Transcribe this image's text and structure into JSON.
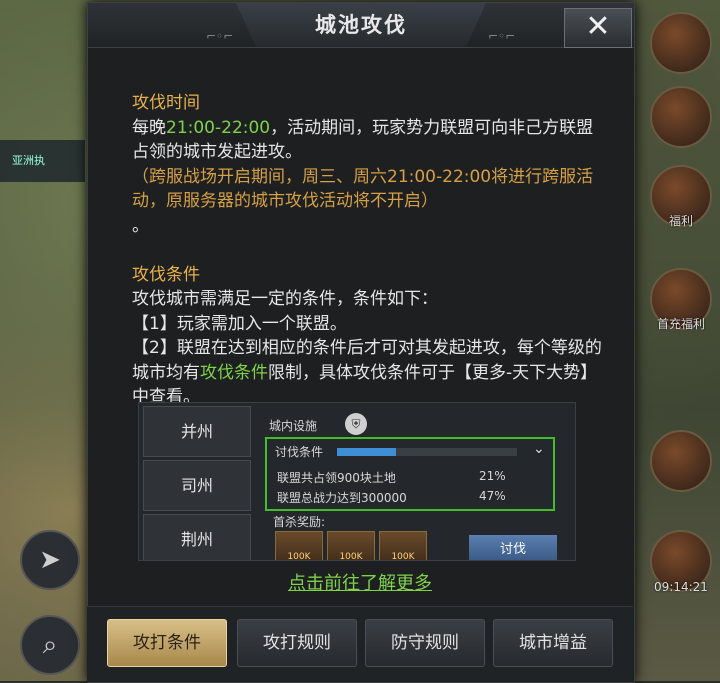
{
  "background": {
    "left_bar_text": "亚洲执",
    "side_labels": [
      "福利",
      "",
      "首充福利"
    ],
    "time": "09:14:21"
  },
  "dialog": {
    "title": "城池攻伐",
    "close_label": "✕",
    "sections": {
      "time_heading": "攻伐时间",
      "time_line1_pre": "每晚",
      "time_line1_hl": "21:00-22:00",
      "time_line1_post": "，活动期间，玩家势力联盟可向非己方联盟占领的城市发起进攻。",
      "time_note": "（跨服战场开启期间，周三、周六21:00-22:00将进行跨服活动，原服务器的城市攻伐活动将不开启）",
      "time_dot": "。",
      "cond_heading": "攻伐条件",
      "cond_line1": "攻伐城市需满足一定的条件，条件如下：",
      "cond_line2": "【1】玩家需加入一个联盟。",
      "cond_line3": "【2】联盟在达到相应的条件后才可对其发起进攻，每个等级的城市均有",
      "cond_line3_hl": "攻伐条件",
      "cond_line3_post": "限制，具体攻伐条件可于【更多-天下大势】中查看。"
    },
    "embed": {
      "cities": [
        "并州",
        "司州",
        "荆州"
      ],
      "facility_label": "城内设施",
      "cond_label": "讨伐条件",
      "progress": 0.33,
      "rows": [
        {
          "text": "联盟共占领900块土地",
          "pct": "21%"
        },
        {
          "text": "联盟总战力达到300000",
          "pct": "47%"
        }
      ],
      "reward_label": "首杀奖励:",
      "reward_items": [
        "100K",
        "100K",
        "100K"
      ],
      "attack_button": "讨伐"
    },
    "more_link": "点击前往了解更多",
    "tabs": [
      "攻打条件",
      "攻打规则",
      "防守规则",
      "城市增益"
    ],
    "active_tab": 0
  }
}
